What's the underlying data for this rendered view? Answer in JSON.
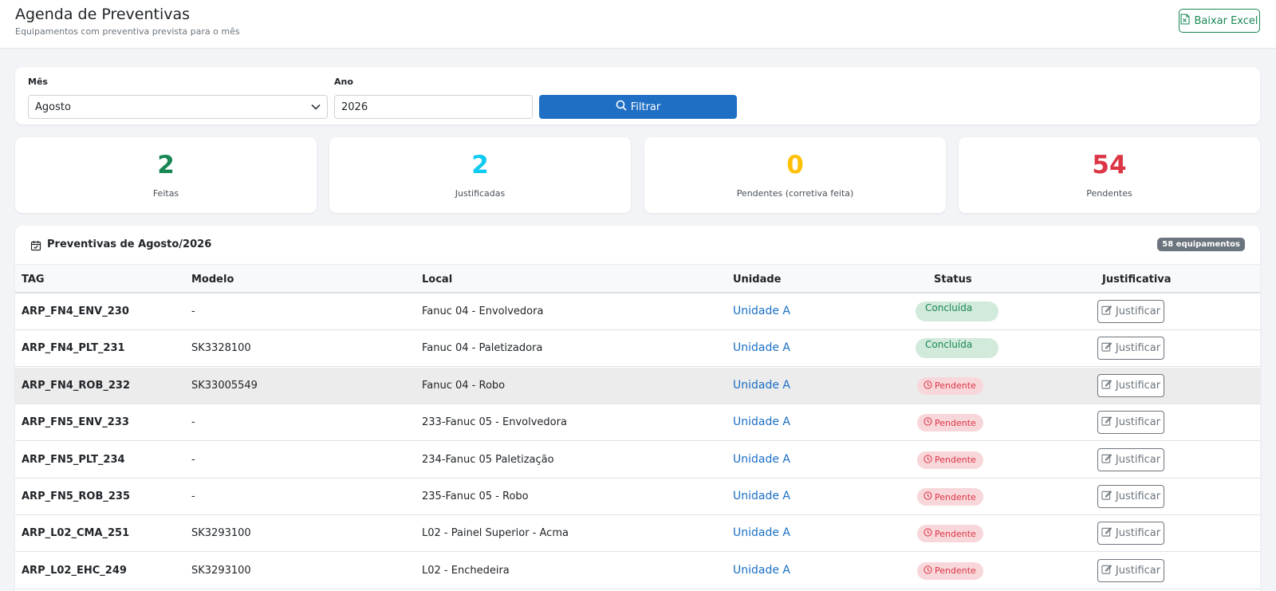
{
  "header": {
    "title": "Agenda de Preventivas",
    "subtitle": "Equipamentos com preventiva prevista para o mês",
    "excel_button": "Baixar Excel",
    "excel_icon": "file-excel-icon"
  },
  "filters": {
    "month_label": "Mês",
    "month_value": "Agosto",
    "year_label": "Ano",
    "year_value": "2026",
    "filter_button": "Filtrar",
    "filter_icon": "search-icon"
  },
  "stats": [
    {
      "value": "2",
      "label": "Feitas",
      "color": "#198754"
    },
    {
      "value": "2",
      "label": "Justificadas",
      "color": "#0dcaf0"
    },
    {
      "value": "0",
      "label": "Pendentes (corretiva feita)",
      "color": "#ffc107"
    },
    {
      "value": "54",
      "label": "Pendentes",
      "color": "#dc3545"
    }
  ],
  "table": {
    "title": "Preventivas de Agosto/2026",
    "title_icon": "calendar-check-icon",
    "count_badge": "58 equipamentos",
    "columns": [
      "TAG",
      "Modelo",
      "Local",
      "Unidade",
      "Status",
      "Justificativa"
    ],
    "action_label": "Justificar",
    "action_icon": "edit-icon",
    "rows": [
      {
        "tag": "ARP_FN4_ENV_230",
        "modelo": "-",
        "local": "Fanuc 04 - Envolvedora",
        "unidade": "Unidade A",
        "status": "Concluída",
        "status_type": "done"
      },
      {
        "tag": "ARP_FN4_PLT_231",
        "modelo": "SK3328100",
        "local": "Fanuc 04 - Paletizadora",
        "unidade": "Unidade A",
        "status": "Concluída",
        "status_type": "done"
      },
      {
        "tag": "ARP_FN4_ROB_232",
        "modelo": "SK33005549",
        "local": "Fanuc 04 - Robo",
        "unidade": "Unidade A",
        "status": "Pendente",
        "status_type": "pending"
      },
      {
        "tag": "ARP_FN5_ENV_233",
        "modelo": "-",
        "local": "233-Fanuc 05 - Envolvedora",
        "unidade": "Unidade A",
        "status": "Pendente",
        "status_type": "pending"
      },
      {
        "tag": "ARP_FN5_PLT_234",
        "modelo": "-",
        "local": "234-Fanuc 05 Paletização",
        "unidade": "Unidade A",
        "status": "Pendente",
        "status_type": "pending"
      },
      {
        "tag": "ARP_FN5_ROB_235",
        "modelo": "-",
        "local": "235-Fanuc 05 - Robo",
        "unidade": "Unidade A",
        "status": "Pendente",
        "status_type": "pending"
      },
      {
        "tag": "ARP_L02_CMA_251",
        "modelo": "SK3293100",
        "local": "L02 - Painel Superior - Acma",
        "unidade": "Unidade A",
        "status": "Pendente",
        "status_type": "pending"
      },
      {
        "tag": "ARP_L02_EHC_249",
        "modelo": "SK3293100",
        "local": "L02 - Enchedeira",
        "unidade": "Unidade A",
        "status": "Pendente",
        "status_type": "pending"
      }
    ]
  }
}
